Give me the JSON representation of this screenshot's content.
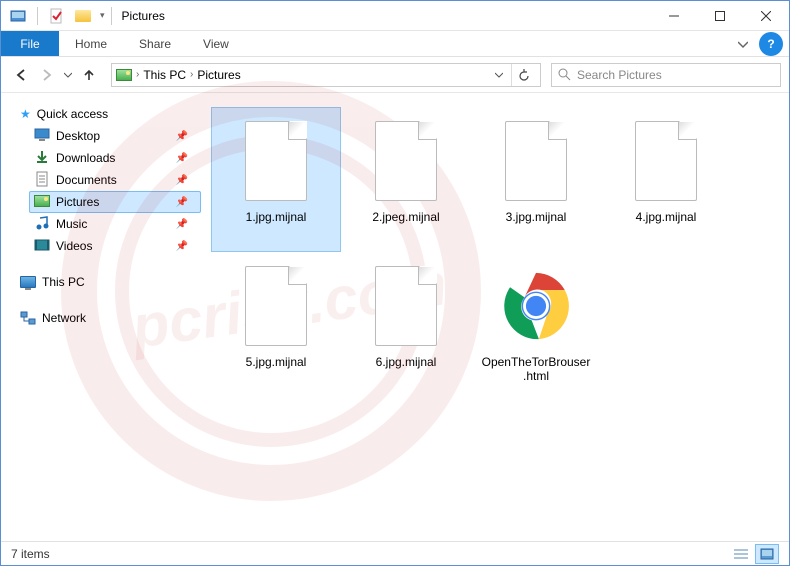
{
  "window": {
    "title": "Pictures"
  },
  "ribbon": {
    "file": "File",
    "tabs": [
      "Home",
      "Share",
      "View"
    ]
  },
  "breadcrumb": {
    "root": "This PC",
    "current": "Pictures"
  },
  "search": {
    "placeholder": "Search Pictures"
  },
  "sidebar": {
    "quick_access": "Quick access",
    "pinned": [
      {
        "label": "Desktop",
        "icon": "desktop"
      },
      {
        "label": "Downloads",
        "icon": "downloads"
      },
      {
        "label": "Documents",
        "icon": "documents"
      },
      {
        "label": "Pictures",
        "icon": "pictures",
        "selected": true
      },
      {
        "label": "Music",
        "icon": "music"
      },
      {
        "label": "Videos",
        "icon": "videos"
      }
    ],
    "this_pc": "This PC",
    "network": "Network"
  },
  "files": [
    {
      "name": "1.jpg.mijnal",
      "type": "blank",
      "selected": true
    },
    {
      "name": "2.jpeg.mijnal",
      "type": "blank"
    },
    {
      "name": "3.jpg.mijnal",
      "type": "blank"
    },
    {
      "name": "4.jpg.mijnal",
      "type": "blank"
    },
    {
      "name": "5.jpg.mijnal",
      "type": "blank"
    },
    {
      "name": "6.jpg.mijnal",
      "type": "blank"
    },
    {
      "name": "OpenTheTorBrouser.html",
      "type": "chrome"
    }
  ],
  "status": {
    "count": "7 items"
  }
}
